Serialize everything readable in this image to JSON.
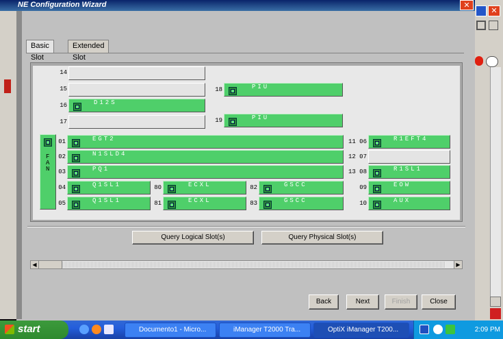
{
  "window": {
    "title": "NE Configuration Wizard",
    "close_glyph": "✕"
  },
  "tabs": [
    {
      "label": "Basic Slot"
    },
    {
      "label": "Extended Slot"
    }
  ],
  "fan": {
    "letters": [
      "F",
      "A",
      "N"
    ]
  },
  "slots": {
    "s14": {
      "num": "14",
      "name": ""
    },
    "s15": {
      "num": "15",
      "name": ""
    },
    "s16": {
      "num": "16",
      "name": "D12S"
    },
    "s17": {
      "num": "17",
      "name": ""
    },
    "s18": {
      "num": "18",
      "name": "PIU"
    },
    "s19": {
      "num": "19",
      "name": "PIU"
    },
    "s01": {
      "num": "01",
      "name": "EGT2"
    },
    "s02": {
      "num": "02",
      "name": "N1SLD4"
    },
    "s03": {
      "num": "03",
      "name": "PQ1"
    },
    "s04": {
      "num": "04",
      "name": "Q1SL1"
    },
    "s05": {
      "num": "05",
      "name": "Q1SL1"
    },
    "s80": {
      "num": "80",
      "name": "ECXL"
    },
    "s81": {
      "num": "81",
      "name": "ECXL"
    },
    "s82": {
      "num": "82",
      "name": "GSCC"
    },
    "s83": {
      "num": "83",
      "name": "GSCC"
    },
    "s06": {
      "num": "11 06",
      "name": "R1EFT4"
    },
    "s07": {
      "num": "12 07",
      "name": ""
    },
    "s08": {
      "num": "13 08",
      "name": "R1SL1"
    },
    "s09": {
      "num": "09",
      "name": "EOW"
    },
    "s10": {
      "num": "10",
      "name": "AUX"
    }
  },
  "query": {
    "logical": "Query Logical Slot(s)",
    "physical": "Query Physical Slot(s)"
  },
  "nav": {
    "back": "Back",
    "next": "Next",
    "finish": "Finish",
    "close": "Close"
  },
  "taskbar": {
    "start": "start",
    "items": [
      {
        "label": "Documento1 - Micro..."
      },
      {
        "label": "iManager T2000 Tra..."
      },
      {
        "label": "OptiX iManager T200..."
      }
    ],
    "time": "2:09 PM"
  },
  "colors": {
    "slot_active": "#4fcf6a",
    "slot_empty": "#e4e4e4",
    "taskbar": "#245edb",
    "start": "#2e8a2e"
  }
}
